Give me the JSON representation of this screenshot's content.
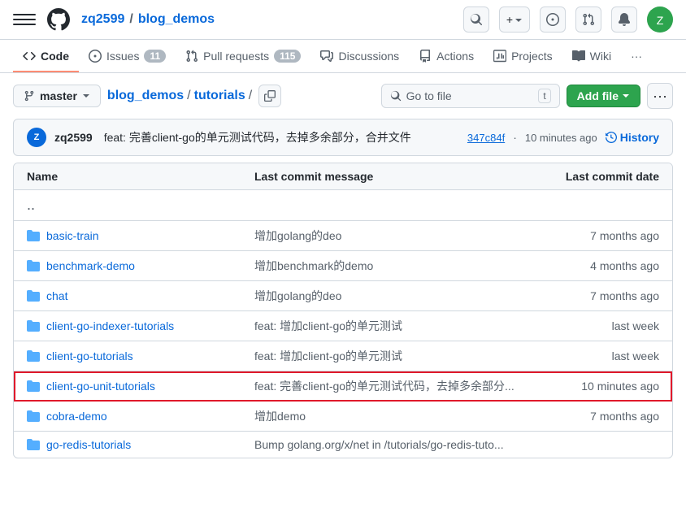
{
  "nav": {
    "hamburger_label": "Toggle nav",
    "user": "zq2599",
    "repo": "blog_demos",
    "search_placeholder": "Search...",
    "plus_label": "+",
    "avatar_initials": "Z"
  },
  "tabs": [
    {
      "id": "code",
      "label": "Code",
      "icon": "<>",
      "active": true,
      "badge": null
    },
    {
      "id": "issues",
      "label": "Issues",
      "icon": "○",
      "active": false,
      "badge": "11"
    },
    {
      "id": "pulls",
      "label": "Pull requests",
      "icon": "⤴",
      "active": false,
      "badge": "115"
    },
    {
      "id": "discussions",
      "label": "Discussions",
      "icon": "☰",
      "active": false,
      "badge": null
    },
    {
      "id": "actions",
      "label": "Actions",
      "icon": "▶",
      "active": false,
      "badge": null
    },
    {
      "id": "projects",
      "label": "Projects",
      "icon": "⊞",
      "active": false,
      "badge": null
    },
    {
      "id": "wiki",
      "label": "Wiki",
      "icon": "☰",
      "active": false,
      "badge": null
    },
    {
      "id": "more",
      "label": "···",
      "icon": "",
      "active": false,
      "badge": null
    }
  ],
  "toolbar": {
    "branch": "master",
    "path": [
      {
        "label": "blog_demos",
        "href": "#"
      },
      {
        "label": "tutorials",
        "href": "#"
      }
    ],
    "goto_file_placeholder": "Go to file",
    "goto_file_shortcut": "t",
    "add_file_label": "Add file",
    "more_label": "···"
  },
  "commit": {
    "author": "zq2599",
    "message": "feat: 完善client-go的单元测试代码，去掉多余部分，合并文件",
    "hash": "347c84f",
    "time": "10 minutes ago",
    "history_label": "History"
  },
  "table": {
    "col_name": "Name",
    "col_message": "Last commit message",
    "col_date": "Last commit date",
    "rows": [
      {
        "name": "..",
        "type": "parent",
        "message": "",
        "date": "",
        "highlighted": false
      },
      {
        "name": "basic-train",
        "type": "folder",
        "message": "增加golang的deo",
        "date": "7 months ago",
        "highlighted": false
      },
      {
        "name": "benchmark-demo",
        "type": "folder",
        "message": "增加benchmark的demo",
        "date": "4 months ago",
        "highlighted": false
      },
      {
        "name": "chat",
        "type": "folder",
        "message": "增加golang的deo",
        "date": "7 months ago",
        "highlighted": false
      },
      {
        "name": "client-go-indexer-tutorials",
        "type": "folder",
        "message": "feat: 增加client-go的单元测试",
        "date": "last week",
        "highlighted": false
      },
      {
        "name": "client-go-tutorials",
        "type": "folder",
        "message": "feat: 增加client-go的单元测试",
        "date": "last week",
        "highlighted": false
      },
      {
        "name": "client-go-unit-tutorials",
        "type": "folder",
        "message": "feat: 完善client-go的单元测试代码，去掉多余部分...",
        "date": "10 minutes ago",
        "highlighted": true
      },
      {
        "name": "cobra-demo",
        "type": "folder",
        "message": "增加demo",
        "date": "7 months ago",
        "highlighted": false
      },
      {
        "name": "go-redis-tutorials",
        "type": "folder",
        "message": "Bump golang.org/x/net in /tutorials/go-redis-tuto...",
        "date": "",
        "highlighted": false
      }
    ]
  }
}
